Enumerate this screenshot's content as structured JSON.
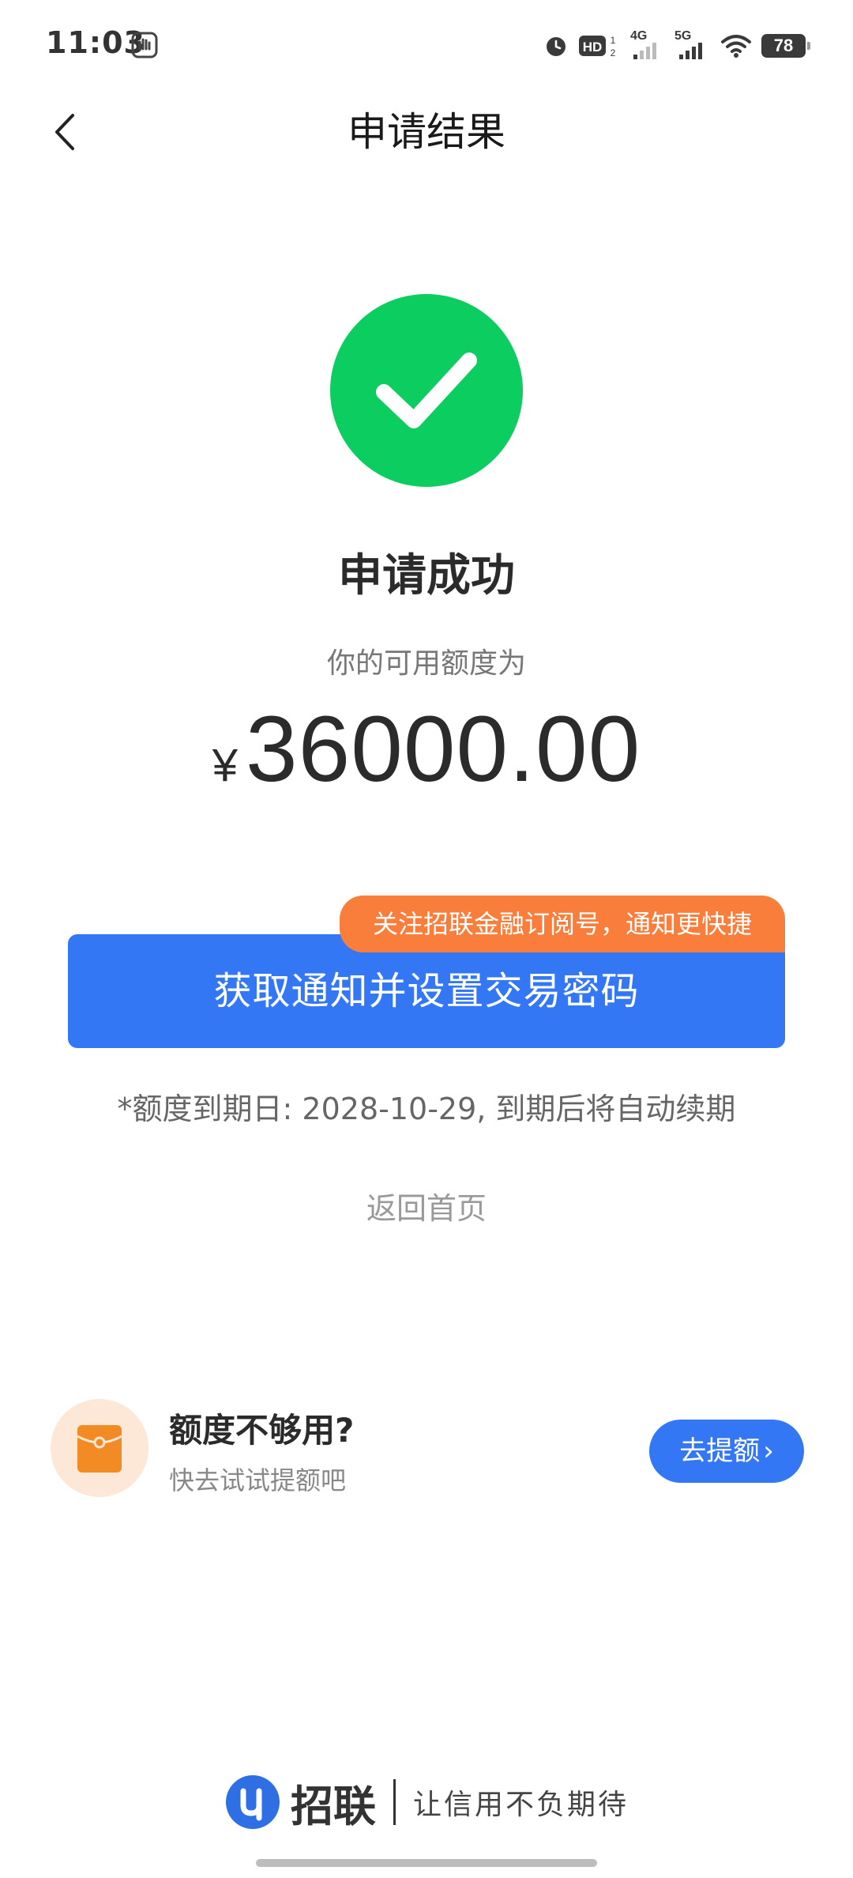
{
  "status_bar": {
    "time": "11:03",
    "battery": "78",
    "network_4g": "4G",
    "network_5g": "5G"
  },
  "header": {
    "title": "申请结果"
  },
  "result": {
    "title": "申请成功",
    "limit_label": "你的可用额度为",
    "currency_symbol": "¥",
    "amount": "36000.00",
    "success_color": "#0ccd5f"
  },
  "actions": {
    "promo_tag": "关注招联金融订阅号，通知更快捷",
    "primary_label": "获取通知并设置交易密码",
    "expiry_note": "*额度到期日: 2028-10-29, 到期后将自动续期",
    "home_link": "返回首页",
    "accent_color": "#3377f5",
    "tag_color": "#f97d3b"
  },
  "promo_card": {
    "title": "额度不够用?",
    "subtitle": "快去试试提额吧",
    "button_label": "去提额",
    "icon": "red-envelope-icon"
  },
  "footer": {
    "brand_name": "招联",
    "slogan": "让信用不负期待"
  }
}
